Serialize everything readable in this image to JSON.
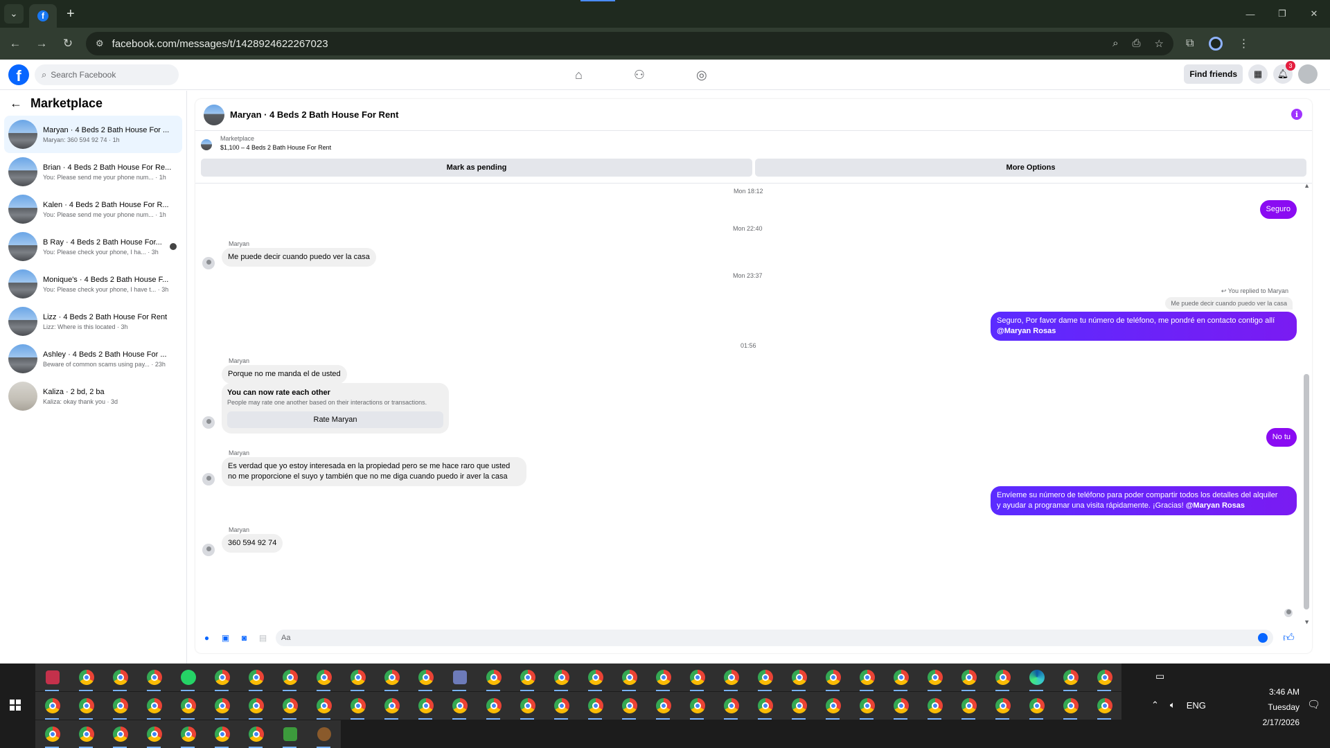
{
  "browser": {
    "url": "facebook.com/messages/t/1428924622267023",
    "tab_menu_icon": "chevron-down-icon",
    "new_tab_label": "+"
  },
  "header": {
    "search_placeholder": "Search Facebook",
    "find_friends": "Find friends",
    "notification_count": "3"
  },
  "sidebar": {
    "title": "Marketplace",
    "conversations": [
      {
        "name": "Maryan · 4 Beds 2 Bath House For ...",
        "preview": "Maryan: 360 594 92 74 · 1h",
        "active": true
      },
      {
        "name": "Brian · 4 Beds 2 Bath House For Re...",
        "preview": "You: Please send me your phone num... · 1h"
      },
      {
        "name": "Kalen · 4 Beds 2 Bath House For R...",
        "preview": "You: Please send me your phone num... · 1h"
      },
      {
        "name": "B Ray · 4 Beds 2 Bath House For...",
        "preview": "You: Please check your phone, I ha... · 3h"
      },
      {
        "name": "Monique's · 4 Beds 2 Bath House F...",
        "preview": "You: Please check your phone, I have t... · 3h"
      },
      {
        "name": "Lizz · 4 Beds 2 Bath House For Rent",
        "preview": "Lizz: Where is this located · 3h"
      },
      {
        "name": "Ashley · 4 Beds 2 Bath House For ...",
        "preview": "Beware of common scams using pay... · 23h"
      },
      {
        "name": "Kaliza · 2 bd, 2 ba",
        "preview": "Kaliza: okay thank you · 3d"
      }
    ]
  },
  "chat": {
    "title": "Maryan · 4 Beds 2 Bath House For Rent",
    "listing_label": "Marketplace",
    "listing_price": "$1,100 – 4 Beds 2 Bath House For Rent",
    "mark_pending": "Mark as pending",
    "more_options": "More Options",
    "ts1": "Mon 18:12",
    "out1": "Seguro",
    "ts2": "Mon 22:40",
    "sender1": "Maryan",
    "in1": "Me puede decir cuando puedo ver la casa",
    "ts3": "Mon 23:37",
    "replied_to": "You replied to Maryan",
    "reply_quote": "Me puede decir cuando puedo ver la casa",
    "out2_line1": "Seguro, Por favor dame tu número de teléfono, me pondré en contacto contigo allí",
    "out2_mention": "@Maryan Rosas",
    "ts4": "01:56",
    "sender2": "Maryan",
    "in2": "Porque no me manda el de usted",
    "rate_title": "You can now rate each other",
    "rate_sub": "People may rate one another based on their interactions or transactions.",
    "rate_button": "Rate Maryan",
    "out3": "No tu",
    "sender3": "Maryan",
    "in3_line1": "Es verdad que yo estoy interesada en la propiedad pero se me hace raro que usted",
    "in3_line2": "no me proporcione el suyo y también que no me diga cuando puedo ir aver la casa",
    "out4_line1": "Envíeme su número de teléfono para poder compartir todos los detalles del alquiler",
    "out4_line2": "y ayudar a programar una visita rápidamente. ¡Gracias!",
    "out4_mention": "@Maryan Rosas",
    "sender4": "Maryan",
    "in4": "360 594 92 74",
    "composer_placeholder": "Aa"
  },
  "taskbar": {
    "time": "3:46 AM",
    "day": "Tuesday",
    "date": "2/17/2026",
    "lang": "ENG"
  }
}
